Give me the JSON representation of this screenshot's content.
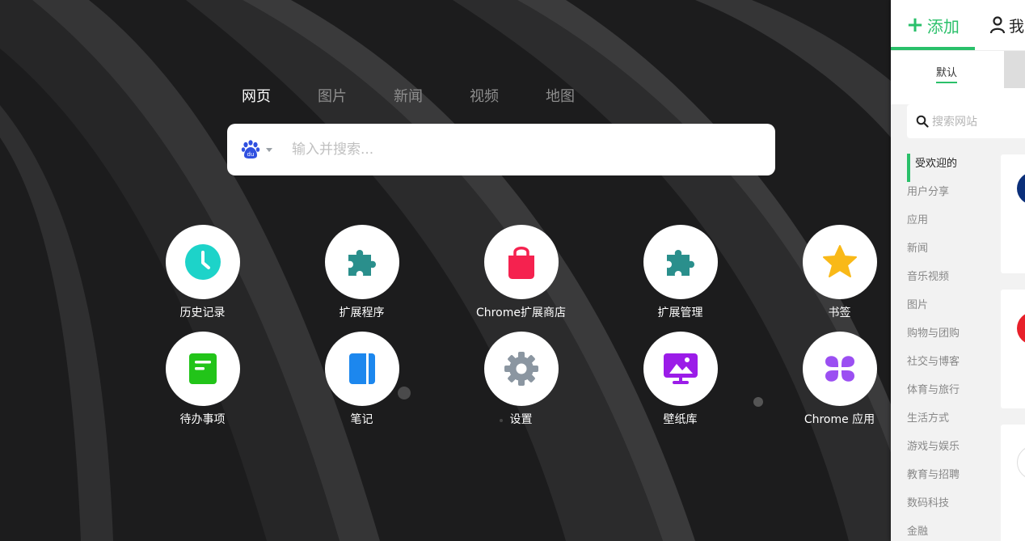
{
  "search": {
    "tabs": [
      "网页",
      "图片",
      "新闻",
      "视频",
      "地图"
    ],
    "active_tab": "网页",
    "engine_icon": "baidu-paw-icon",
    "placeholder": "输入并搜索..."
  },
  "apps": [
    {
      "label": "历史记录",
      "icon": "clock-icon",
      "color": "#1dd3c9"
    },
    {
      "label": "扩展程序",
      "icon": "puzzle-icon",
      "color": "#2a8f8c"
    },
    {
      "label": "Chrome扩展商店",
      "icon": "shopping-bag-icon",
      "color": "#f5224f"
    },
    {
      "label": "扩展管理",
      "icon": "puzzle-icon",
      "color": "#2a8f8c"
    },
    {
      "label": "书签",
      "icon": "star-icon",
      "color": "#f9b918"
    },
    {
      "label": "待办事项",
      "icon": "todo-icon",
      "color": "#22c419"
    },
    {
      "label": "笔记",
      "icon": "notebook-icon",
      "color": "#1c87ee"
    },
    {
      "label": "设置",
      "icon": "gear-icon",
      "color": "#8b96a1"
    },
    {
      "label": "壁纸库",
      "icon": "wallpaper-icon",
      "color": "#9b1ce8"
    },
    {
      "label": "Chrome 应用",
      "icon": "apps-grid-icon",
      "color": "#9b4ff2"
    }
  ],
  "panel": {
    "add_tab": "添加",
    "mine_tab": "我",
    "sub_tab": "默认",
    "search_placeholder": "搜索网站",
    "categories": [
      "受欢迎的",
      "用户分享",
      "应用",
      "新闻",
      "音乐视频",
      "图片",
      "购物与团购",
      "社交与博客",
      "体育与旅行",
      "生活方式",
      "游戏与娱乐",
      "教育与招聘",
      "数码科技",
      "金融"
    ],
    "active_category": "受欢迎的",
    "accent": "#2ac06a"
  }
}
